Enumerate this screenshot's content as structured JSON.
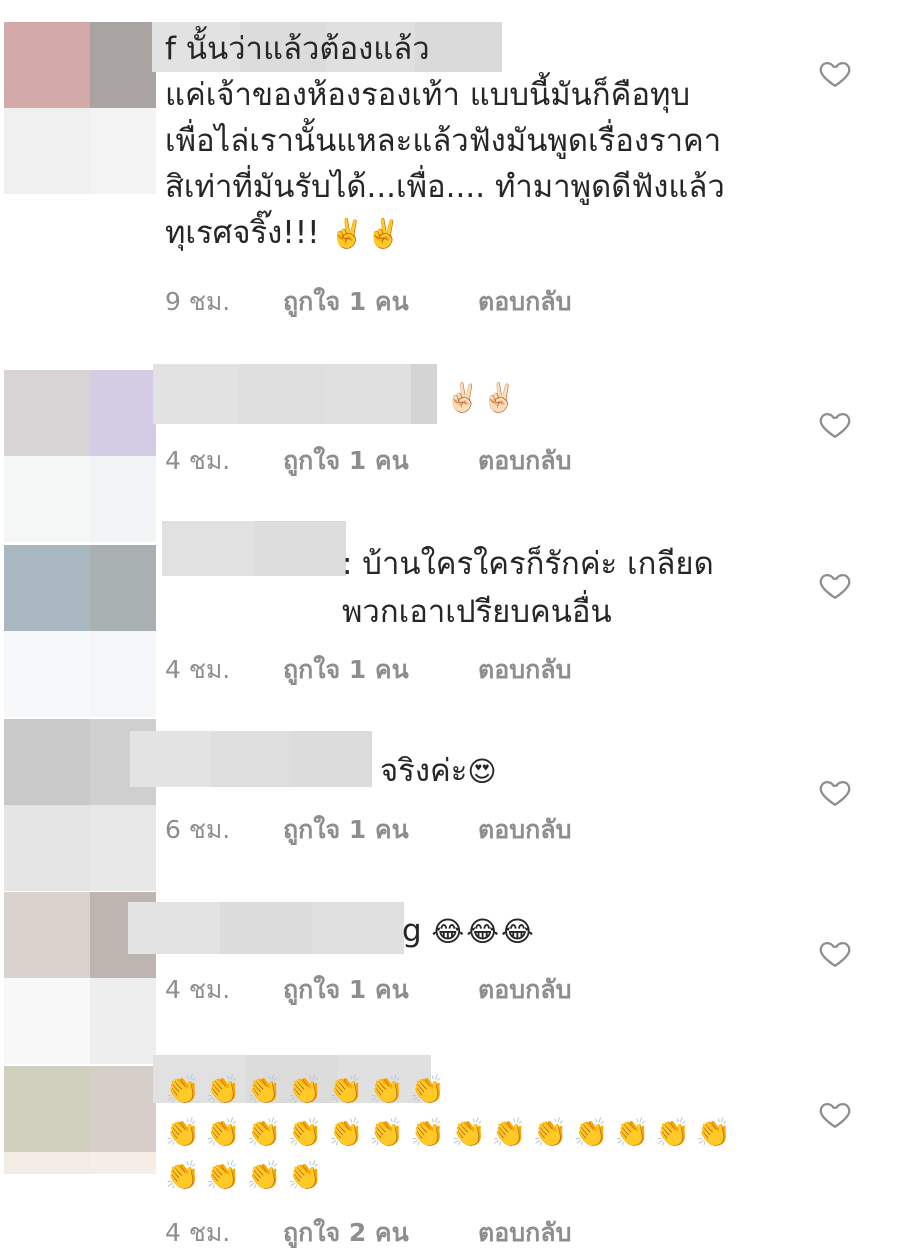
{
  "comments": [
    {
      "text": "f นั้นว่าแล้วต้องแล้ว\nแค่เจ้าของห้องรองเท้า แบบนี้มันก็คือทุบ\nเพื่อไล่เรานั้นแหละแล้วฟังมันพูดเรื่องราคา\nสิเท่าที่มันรับได้...เพื่อ.... ทำมาพูดดีฟังแล้ว\nทุเรศจริ๊ง!!! ",
      "emoji": "✌️✌️",
      "time": "9 ชม.",
      "likes": "ถูกใจ 1 คน",
      "reply": "ตอบกลับ"
    },
    {
      "text": "",
      "emoji": "✌🏻✌🏻",
      "time": "4 ชม.",
      "likes": "ถูกใจ 1 คน",
      "reply": "ตอบกลับ"
    },
    {
      "text": ": บ้านใครใครก็รักค่ะ เกลียด\nพวกเอาเปรียบคนอื่น",
      "emoji": "",
      "time": "4 ชม.",
      "likes": "ถูกใจ 1 คน",
      "reply": "ตอบกลับ"
    },
    {
      "text": "จริงค่ะ",
      "emoji": "😍",
      "time": "6 ชม.",
      "likes": "ถูกใจ 1 คน",
      "reply": "ตอบกลับ"
    },
    {
      "text": "g ",
      "emoji": "😂😂😂",
      "time": "4 ชม.",
      "likes": "ถูกใจ 1 คน",
      "reply": "ตอบกลับ"
    },
    {
      "text": "",
      "emoji": "👏👏👏👏👏👏👏\n👏👏👏👏👏👏👏👏👏👏👏👏👏👏\n👏👏👏👏",
      "time": "4 ชม.",
      "likes": "ถูกใจ 2 คน",
      "reply": "ตอบกลับ"
    }
  ],
  "icons": {
    "like": "heart-outline-icon"
  },
  "colors": {
    "meta": "#8e8e8e",
    "text": "#262626",
    "heart": "#8e8e8e"
  }
}
